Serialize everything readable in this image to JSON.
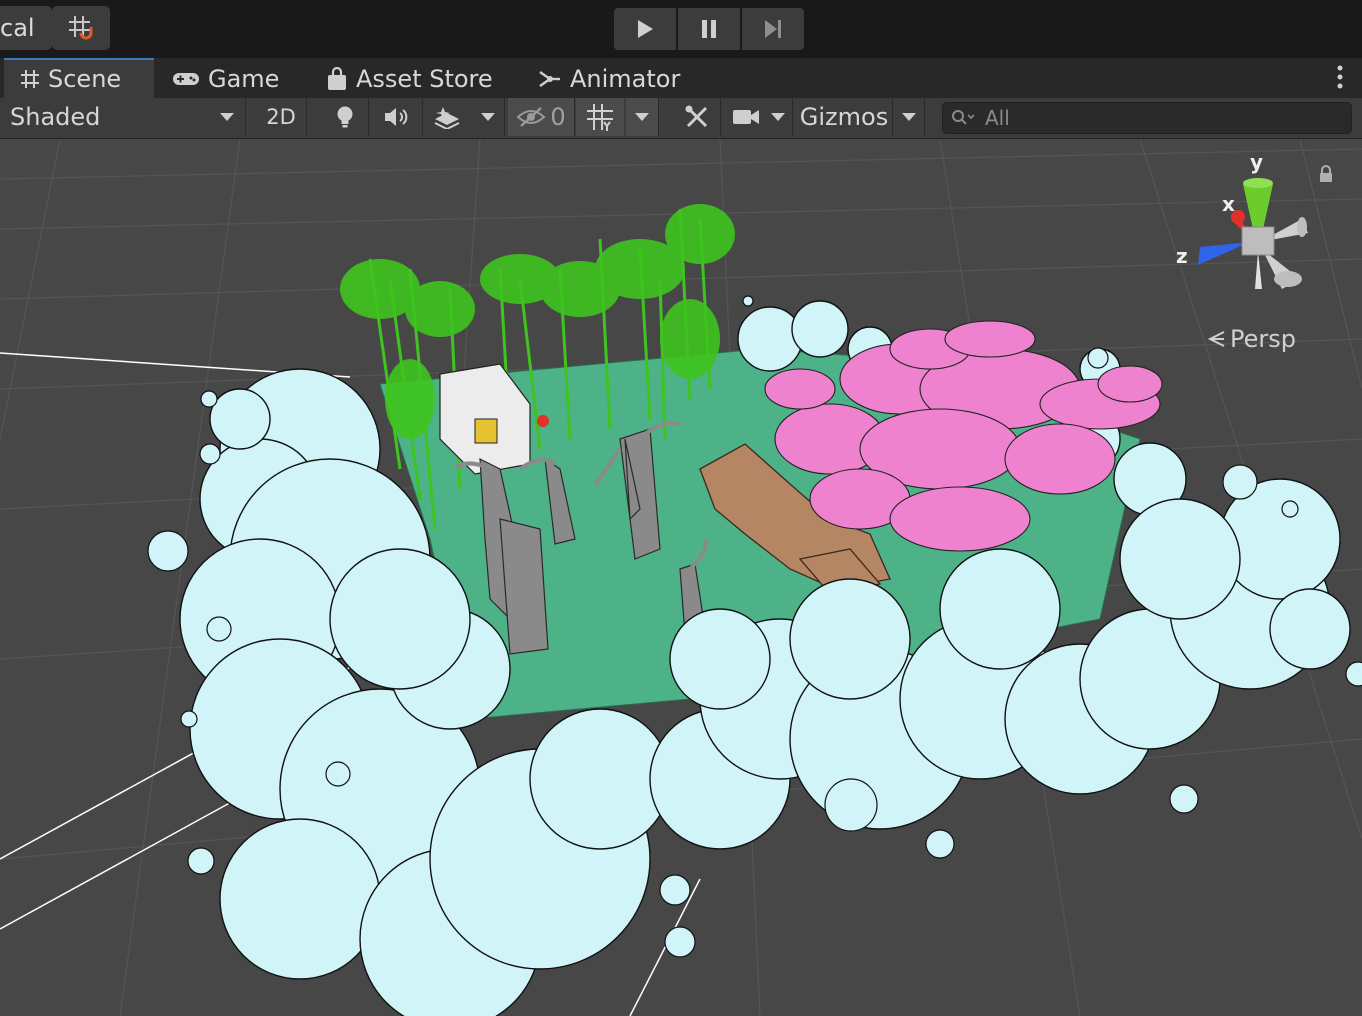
{
  "topbar": {
    "pivot_label": "cal",
    "snap_icon": "grid-snap-icon",
    "play_icons": [
      "play-icon",
      "pause-icon",
      "step-icon"
    ]
  },
  "tabs": [
    {
      "label": "Scene",
      "icon": "scene-grid-icon",
      "active": true
    },
    {
      "label": "Game",
      "icon": "gamepad-icon",
      "active": false
    },
    {
      "label": "Asset Store",
      "icon": "shopping-bag-icon",
      "active": false
    },
    {
      "label": "Animator",
      "icon": "animator-icon",
      "active": false
    }
  ],
  "toolbar": {
    "draw_mode": "Shaded",
    "mode_2d": "2D",
    "hidden_count": "0",
    "gizmos_label": "Gizmos",
    "search_placeholder": "All"
  },
  "viewport": {
    "persp_label": "Persp",
    "gizmo_axes": {
      "x": "x",
      "y": "y",
      "z": "z"
    }
  },
  "colors": {
    "panel": "#3c3c3c",
    "tabbar": "#282828",
    "viewport_bg": "#474747",
    "active_tab_accent": "#3a79bb",
    "cloud": "#d0f4f8",
    "ground": "#4db287",
    "bamboo": "#3ec41e",
    "blossom": "#ef82cf",
    "rock": "#b58663",
    "trunk": "#8a8a8a",
    "axis_x": "#e0322a",
    "axis_y": "#6ccb2d",
    "axis_z": "#2f63e8"
  }
}
